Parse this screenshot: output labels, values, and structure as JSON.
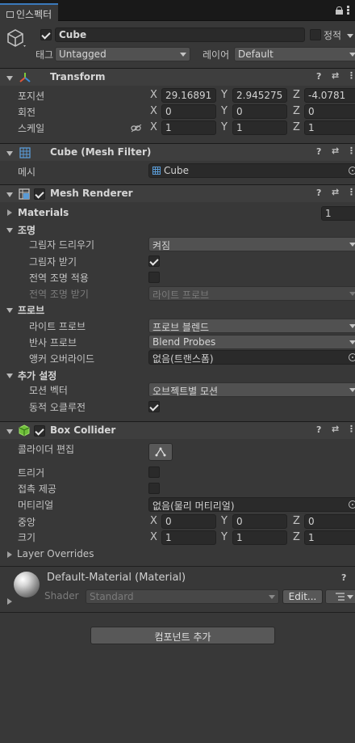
{
  "tab": {
    "title": "인스펙터"
  },
  "object": {
    "name": "Cube",
    "static_label": "정적",
    "tag_label": "태그",
    "tag_value": "Untagged",
    "layer_label": "레이어",
    "layer_value": "Default"
  },
  "transform": {
    "title": "Transform",
    "position_label": "포지션",
    "rotation_label": "회전",
    "scale_label": "스케일",
    "position": {
      "x": "29.16891",
      "y": "2.945275",
      "z": "-4.0781"
    },
    "rotation": {
      "x": "0",
      "y": "0",
      "z": "0"
    },
    "scale": {
      "x": "1",
      "y": "1",
      "z": "1"
    },
    "axis_x": "X",
    "axis_y": "Y",
    "axis_z": "Z"
  },
  "mesh_filter": {
    "title": "Cube (Mesh Filter)",
    "mesh_label": "메시",
    "mesh_value": "Cube"
  },
  "mesh_renderer": {
    "title": "Mesh Renderer",
    "materials_label": "Materials",
    "materials_count": "1",
    "lighting_label": "조명",
    "cast_shadows_label": "그림자 드리우기",
    "cast_shadows_value": "켜짐",
    "receive_shadows_label": "그림자 받기",
    "contribute_gi_label": "전역 조명 적용",
    "receive_gi_label": "전역 조명 받기",
    "receive_gi_value": "라이트 프로브",
    "probes_label": "프로브",
    "light_probes_label": "라이트 프로브",
    "light_probes_value": "프로브 블렌드",
    "reflection_probes_label": "반사 프로브",
    "reflection_probes_value": "Blend Probes",
    "anchor_override_label": "앵커 오버라이드",
    "anchor_override_value": "없음(트랜스폼)",
    "additional_label": "추가 설정",
    "motion_vectors_label": "모션 벡터",
    "motion_vectors_value": "오브젝트별 모션",
    "dynamic_occlusion_label": "동적 오클루전"
  },
  "box_collider": {
    "title": "Box Collider",
    "edit_collider_label": "콜라이더 편집",
    "trigger_label": "트리거",
    "contacts_label": "접촉 제공",
    "material_label": "머티리얼",
    "material_value": "없음(물리 머티리얼)",
    "center_label": "중앙",
    "size_label": "크기",
    "center": {
      "x": "0",
      "y": "0",
      "z": "0"
    },
    "size": {
      "x": "1",
      "y": "1",
      "z": "1"
    },
    "layer_overrides_label": "Layer Overrides"
  },
  "material": {
    "name": "Default-Material (Material)",
    "shader_label": "Shader",
    "shader_value": "Standard",
    "edit_label": "Edit..."
  },
  "add_component_label": "컴포넌트 추가",
  "colors": {
    "accent": "#3a79bb",
    "background": "#383838",
    "header": "#3e3e3e"
  }
}
